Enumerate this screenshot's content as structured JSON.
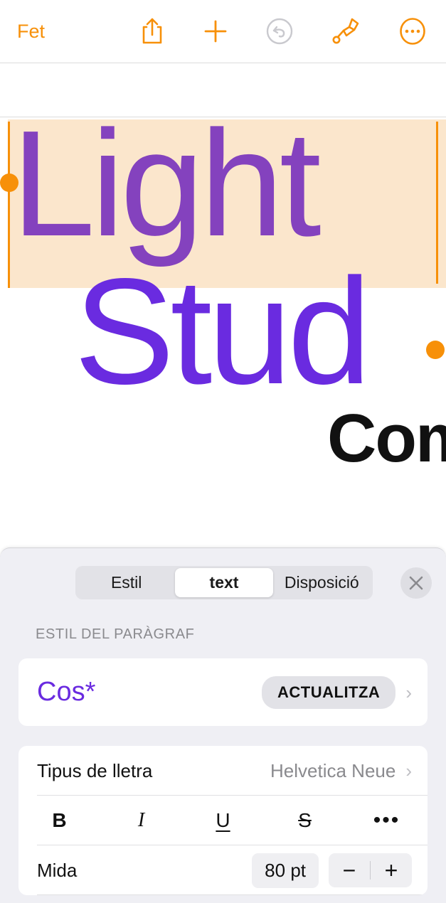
{
  "toolbar": {
    "done_label": "Fet",
    "icons": [
      {
        "name": "share-icon",
        "label": "Comparteix"
      },
      {
        "name": "add-icon",
        "label": "Afegeix"
      },
      {
        "name": "undo-icon",
        "label": "Desfés"
      },
      {
        "name": "paintbrush-icon",
        "label": "Format"
      },
      {
        "name": "more-circle-icon",
        "label": "Més"
      }
    ]
  },
  "document": {
    "line1": "Light",
    "line2": "Stud",
    "line3": "Comp",
    "selection_highlight_color": "#FBE6CC",
    "selected_text_color": "#8442BE",
    "text_color": "#6A2BE0",
    "handle_color": "#F79009"
  },
  "panel": {
    "segments": [
      {
        "label": "Estil",
        "active": false
      },
      {
        "label": "text",
        "active": true
      },
      {
        "label": "Disposició",
        "active": false
      }
    ],
    "close_label": "×",
    "section_header": "ESTIL DEL PARÀGRAF",
    "paragraph_style": {
      "name": "Cos*",
      "update_button": "ACTUALITZA",
      "chevron": "›"
    },
    "font": {
      "label": "Tipus de lletra",
      "value": "Helvetica Neue",
      "chevron": "›"
    },
    "format_buttons": [
      {
        "name": "bold-button",
        "label": "B"
      },
      {
        "name": "italic-button",
        "label": "I"
      },
      {
        "name": "underline-button",
        "label": "U"
      },
      {
        "name": "strikethrough-button",
        "label": "S"
      },
      {
        "name": "more-format-button",
        "label": "•••"
      }
    ],
    "size": {
      "label": "Mida",
      "value": "80 pt",
      "decrement": "−",
      "increment": "+"
    }
  },
  "colors": {
    "accent_orange": "#F79009",
    "purple": "#6A2BE0",
    "panel_bg": "#EFEFF4",
    "card_bg": "#FFFFFF"
  }
}
